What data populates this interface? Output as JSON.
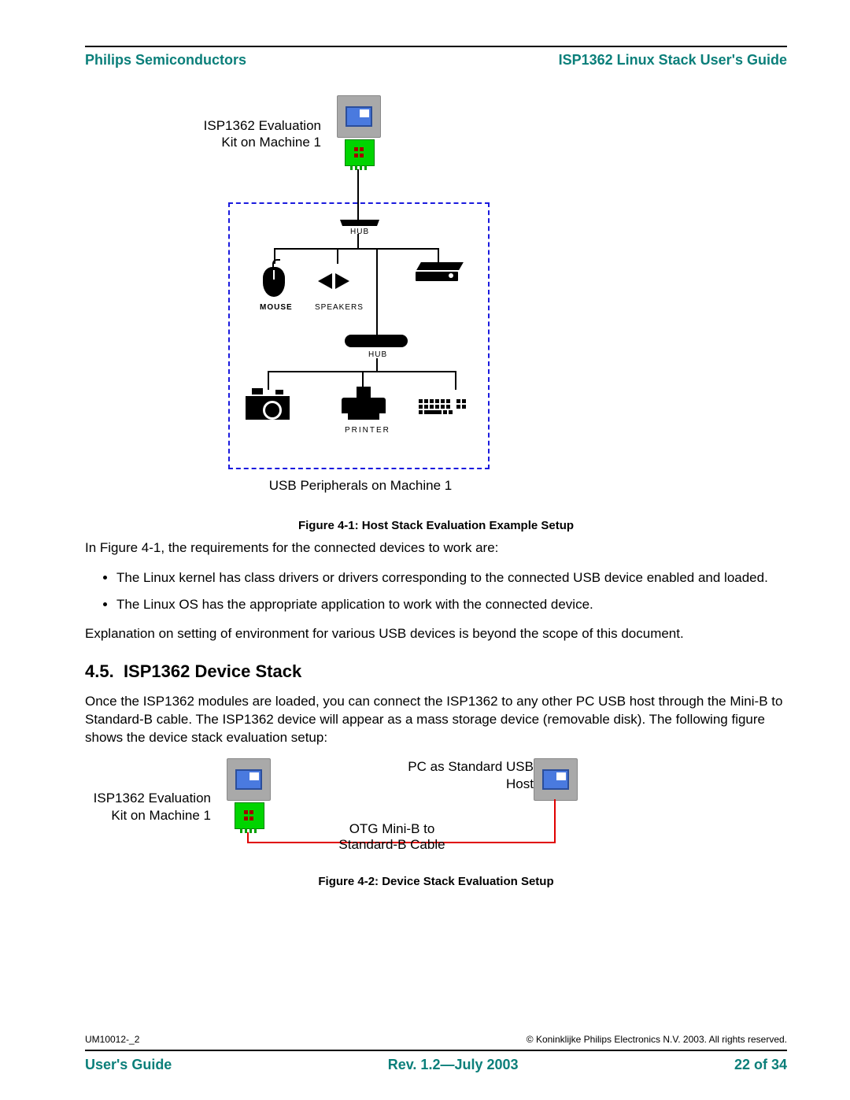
{
  "header": {
    "left": "Philips Semiconductors",
    "right": "ISP1362 Linux Stack User's Guide"
  },
  "diagram1": {
    "label_kit": "ISP1362 Evaluation\nKit on Machine 1",
    "hub_label_1": "HUB",
    "mouse_label": "MOUSE",
    "speakers_label": "SPEAKERS",
    "hub_label_2": "HUB",
    "printer_label": "PRINTER",
    "bottom_label": "USB Peripherals on Machine 1",
    "caption": "Figure 4-1: Host Stack Evaluation Example Setup"
  },
  "body": {
    "intro": "In Figure 4-1, the requirements for the connected devices to work are:",
    "bullets": [
      "The Linux kernel has class drivers or drivers corresponding to the connected USB device enabled and loaded.",
      "The Linux OS has the appropriate application to work with the connected device."
    ],
    "outro": "Explanation on setting of environment for various USB devices is beyond the scope of this document."
  },
  "section": {
    "number": "4.5.",
    "title": "ISP1362 Device Stack",
    "para": "Once the ISP1362 modules are loaded, you can connect the ISP1362 to any other PC USB host through the Mini-B to Standard-B cable. The ISP1362 device will appear as a mass storage device (removable disk). The following figure shows the device stack evaluation setup:"
  },
  "diagram2": {
    "label_kit": "ISP1362 Evaluation\nKit on Machine 1",
    "label_host": "PC as Standard USB\nHost",
    "label_cable": "OTG Mini-B to\nStandard-B Cable",
    "caption": "Figure 4-2: Device Stack Evaluation Setup"
  },
  "footer": {
    "doc_id": "UM10012-_2",
    "copyright": "© Koninklijke Philips Electronics N.V. 2003. All rights reserved.",
    "left": "User's Guide",
    "center": "Rev. 1.2—July 2003",
    "right": "22 of 34"
  }
}
